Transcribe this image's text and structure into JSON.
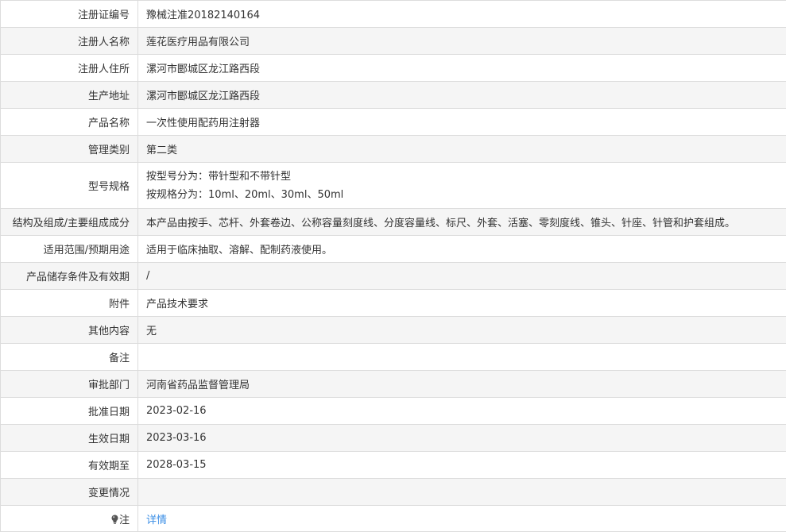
{
  "rows": [
    {
      "label": "注册证编号",
      "value": "豫械注准20182140164"
    },
    {
      "label": "注册人名称",
      "value": "莲花医疗用品有限公司"
    },
    {
      "label": "注册人住所",
      "value": "漯河市郾城区龙江路西段"
    },
    {
      "label": "生产地址",
      "value": "漯河市郾城区龙江路西段"
    },
    {
      "label": "产品名称",
      "value": "一次性使用配药用注射器"
    },
    {
      "label": "管理类别",
      "value": "第二类"
    },
    {
      "label": "型号规格",
      "lines": [
        "按型号分为：带针型和不带针型",
        "按规格分为：10ml、20ml、30ml、50ml"
      ]
    },
    {
      "label": "结构及组成/主要组成成分",
      "value": "本产品由按手、芯杆、外套卷边、公称容量刻度线、分度容量线、标尺、外套、活塞、零刻度线、锥头、针座、针管和护套组成。"
    },
    {
      "label": "适用范围/预期用途",
      "value": "适用于临床抽取、溶解、配制药液使用。"
    },
    {
      "label": "产品储存条件及有效期",
      "value": "/"
    },
    {
      "label": "附件",
      "value": "产品技术要求"
    },
    {
      "label": "其他内容",
      "value": "无"
    },
    {
      "label": "备注",
      "value": ""
    },
    {
      "label": "审批部门",
      "value": "河南省药品监督管理局"
    },
    {
      "label": "批准日期",
      "value": "2023-02-16"
    },
    {
      "label": "生效日期",
      "value": "2023-03-16"
    },
    {
      "label": "有效期至",
      "value": "2028-03-15"
    },
    {
      "label": "变更情况",
      "value": ""
    },
    {
      "label": "注",
      "value": "详情",
      "icon": "lightbulb-icon"
    }
  ],
  "colors": {
    "border": "#dcdcdc",
    "row_alt": "#f5f5f5",
    "text": "#333333",
    "link": "#3a8ee6"
  }
}
